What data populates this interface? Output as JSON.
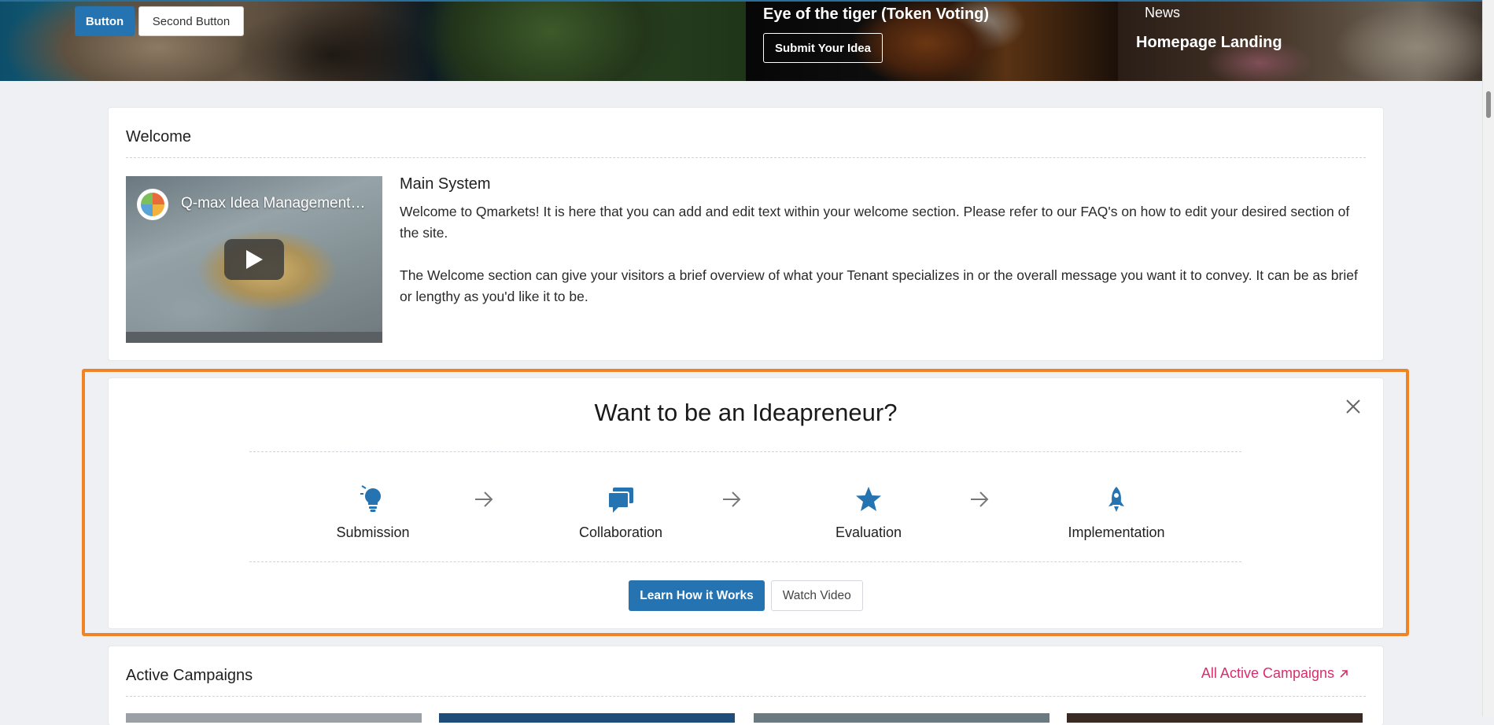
{
  "hero": {
    "slide1": {
      "primary_button": "Button",
      "secondary_button": "Second Button"
    },
    "slide2": {
      "title": "Eye of the tiger (Token Voting)",
      "cta": "Submit Your Idea"
    },
    "slide3": {
      "kicker": "News",
      "heading": "Homepage Landing"
    }
  },
  "welcome": {
    "title": "Welcome",
    "video": {
      "title": "Q-max Idea Management…",
      "icon": "play-icon"
    },
    "heading": "Main System",
    "paragraphs": [
      "Welcome to Qmarkets! It is here that you can add and edit text within your welcome section. Please refer to our FAQ's on how to edit your desired section of the site.",
      "The Welcome section can give your visitors a brief overview of what your Tenant specializes in or the overall message you want it to convey. It can be as brief or lengthy as you'd like it to be."
    ]
  },
  "ideapreneur": {
    "title": "Want to be an Ideapreneur?",
    "steps": [
      {
        "label": "Submission",
        "icon": "lightbulb-icon"
      },
      {
        "label": "Collaboration",
        "icon": "chat-bubbles-icon"
      },
      {
        "label": "Evaluation",
        "icon": "star-icon"
      },
      {
        "label": "Implementation",
        "icon": "rocket-icon"
      }
    ],
    "primary_button": "Learn How it Works",
    "secondary_button": "Watch Video",
    "accent_color": "#2573b0",
    "highlight_color": "#f08424"
  },
  "campaigns": {
    "title": "Active Campaigns",
    "link": "All Active Campaigns",
    "link_color": "#d62e6d"
  }
}
